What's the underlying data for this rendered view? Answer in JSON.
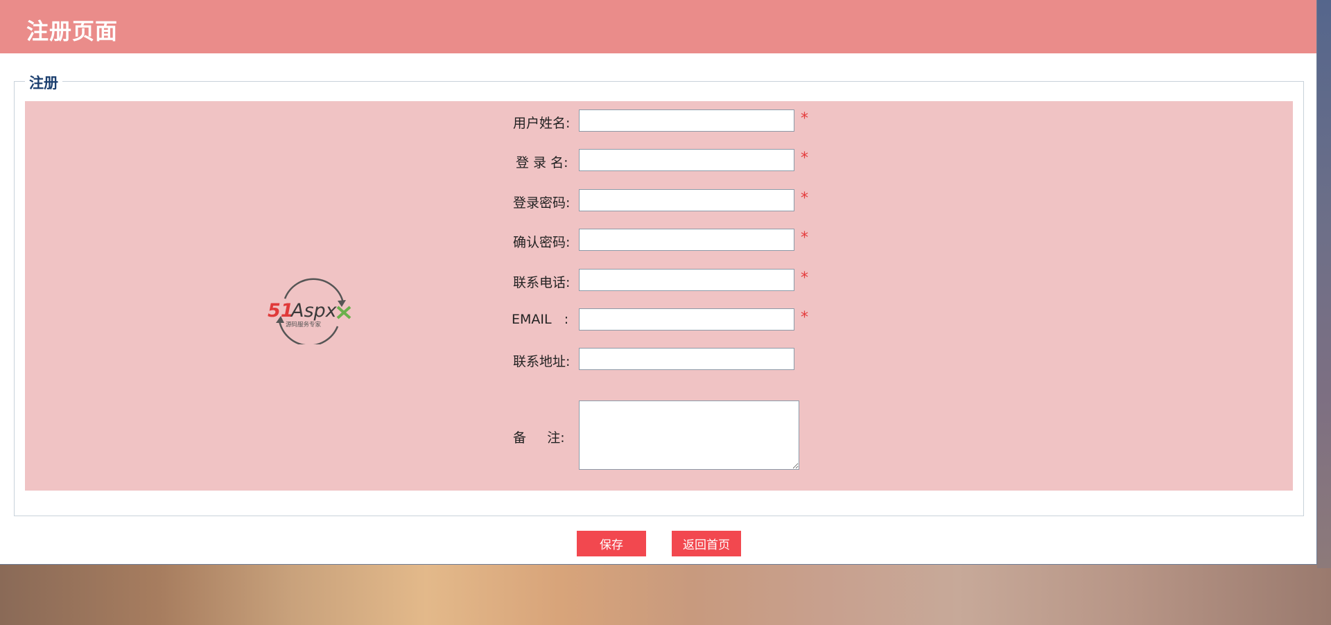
{
  "header": {
    "title": "注册页面"
  },
  "fieldset": {
    "legend": "注册"
  },
  "logo": {
    "brand_red": "51",
    "brand_dark": "Aspx",
    "slogan": "源码服务专家"
  },
  "form": {
    "required_mark": "*",
    "fields": [
      {
        "label": "用户姓名:",
        "value": "",
        "required": true
      },
      {
        "label": "登 录 名:",
        "value": "",
        "required": true
      },
      {
        "label": "登录密码:",
        "value": "",
        "required": true
      },
      {
        "label": "确认密码:",
        "value": "",
        "required": true
      },
      {
        "label": "联系电话:",
        "value": "",
        "required": true
      },
      {
        "label": "EMAIL   :",
        "value": "",
        "required": true
      },
      {
        "label": "联系地址:",
        "value": "",
        "required": false
      }
    ],
    "remark": {
      "label": "备     注:",
      "value": ""
    }
  },
  "buttons": {
    "save": "保存",
    "back_home": "返回首页"
  },
  "colors": {
    "header": "#ea8c8a",
    "panel": "#f0c3c4",
    "button": "#f2484f",
    "required": "#e43b3b",
    "legend": "#1b3e6e"
  }
}
